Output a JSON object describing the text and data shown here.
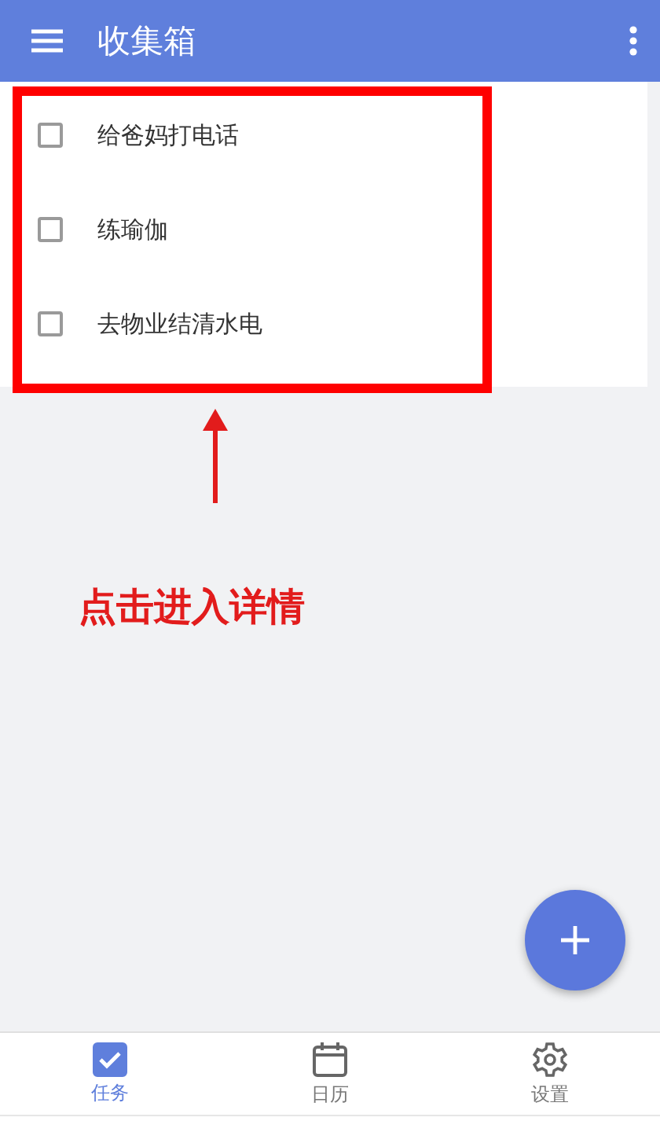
{
  "app_bar": {
    "title": "收集箱"
  },
  "tasks": [
    {
      "title": "给爸妈打电话",
      "checked": false
    },
    {
      "title": "练瑜伽",
      "checked": false
    },
    {
      "title": "去物业结清水电",
      "checked": false
    }
  ],
  "annotation": {
    "text": "点击进入详情"
  },
  "tabs": [
    {
      "label": "任务",
      "selected": true
    },
    {
      "label": "日历",
      "selected": false
    },
    {
      "label": "设置",
      "selected": false
    }
  ]
}
